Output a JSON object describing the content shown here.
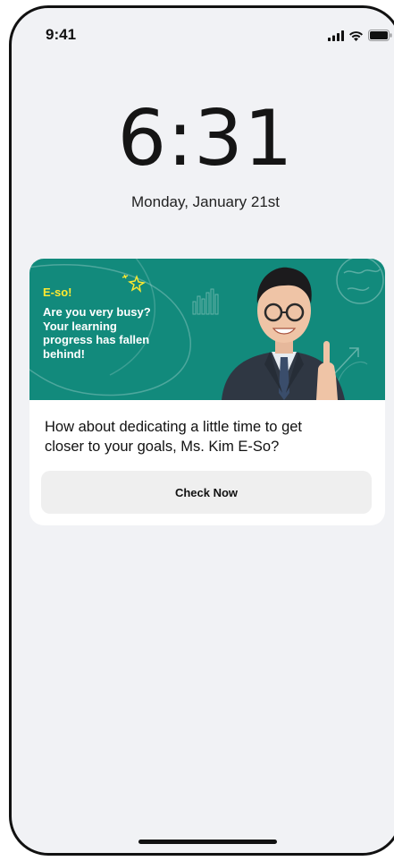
{
  "status_bar": {
    "time": "9:41",
    "icons": [
      "signal-icon",
      "wifi-icon",
      "battery-icon"
    ]
  },
  "lock_screen": {
    "time": "6:31",
    "date": "Monday, January 21st"
  },
  "notification": {
    "banner": {
      "brand": "E-so!",
      "headline_lines": [
        "Are you very busy?",
        "Your learning",
        "progress has fallen",
        "behind!"
      ],
      "background_color": "#128a7c",
      "brand_color": "#ffe930"
    },
    "message_lines": [
      "How about dedicating a little time to get",
      "closer to your goals, Ms. Kim E-So?"
    ],
    "button_label": "Check Now"
  }
}
